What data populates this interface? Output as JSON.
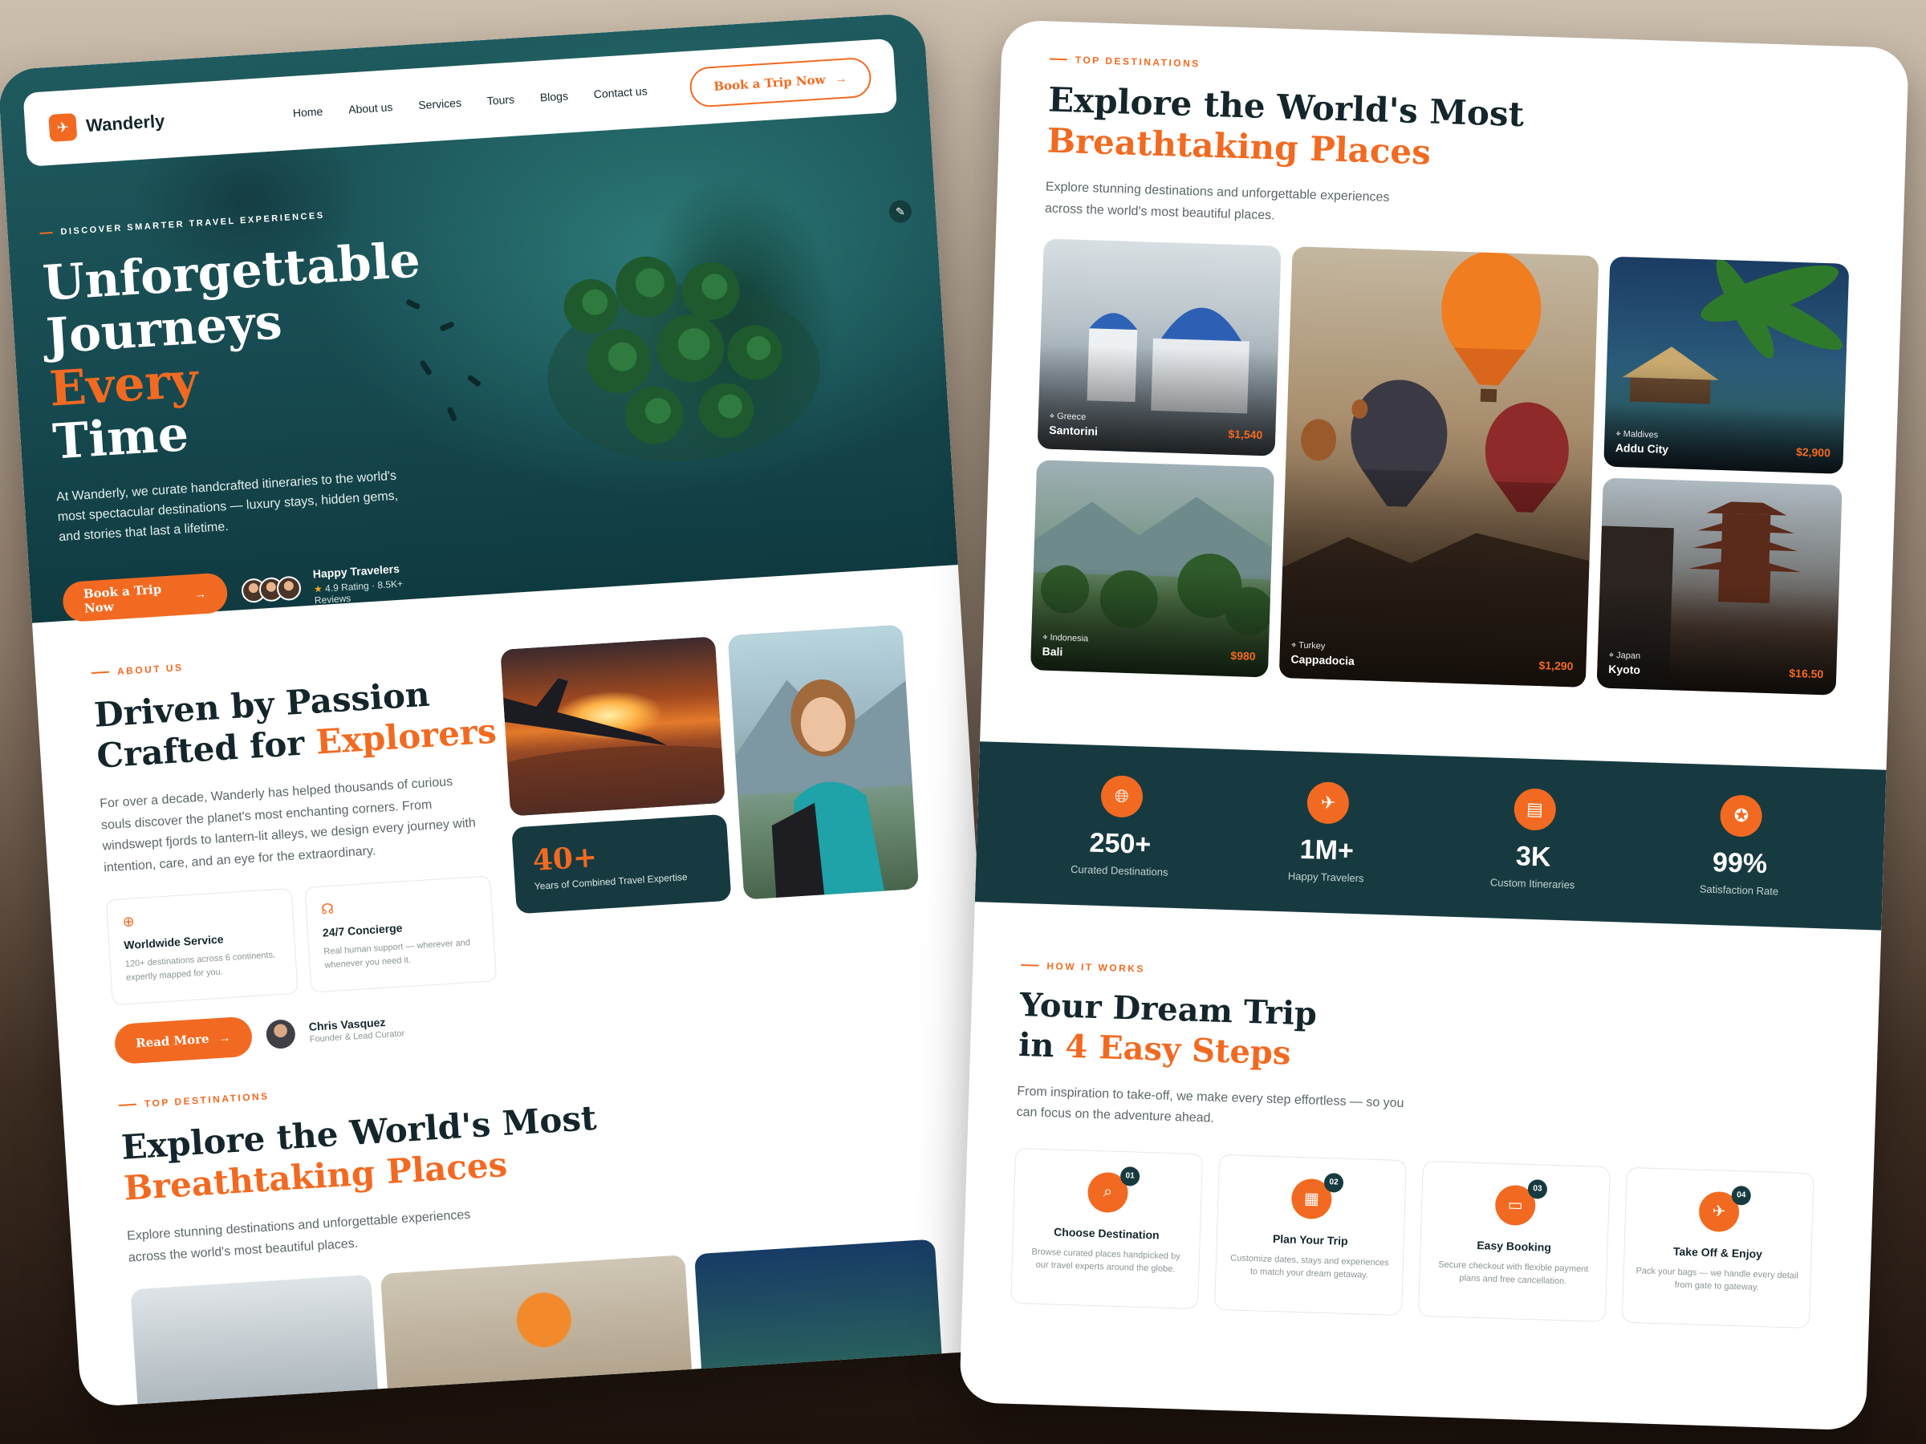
{
  "nav": {
    "brand": "Wanderly",
    "links": [
      "Home",
      "About us",
      "Services",
      "Tours",
      "Blogs",
      "Contact us"
    ],
    "cta": "Book a Trip Now"
  },
  "hero": {
    "kicker": "DISCOVER SMARTER TRAVEL EXPERIENCES",
    "title_line1": "Unforgettable",
    "title_line2a": "Journeys",
    "title_line2b": "Every",
    "title_line3": "Time",
    "description": "At Wanderly, we curate handcrafted itineraries to the world's most spectacular destinations — luxury stays, hidden gems, and stories that last a lifetime.",
    "cta": "Book a Trip Now",
    "social_title": "Happy Travelers",
    "social_sub": "4.9 Rating · 8.5K+ Reviews"
  },
  "about": {
    "kicker": "ABOUT US",
    "title_a": "Driven by Passion",
    "title_b": "Crafted for",
    "title_c": "Explorers",
    "description": "For over a decade, Wanderly has helped thousands of curious souls discover the planet's most enchanting corners. From windswept fjords to lantern-lit alleys, we design every journey with intention, care, and an eye for the extraordinary.",
    "features": [
      {
        "icon": "globe-icon",
        "title": "Worldwide Service",
        "text": "120+ destinations across 6 continents, expertly mapped for you."
      },
      {
        "icon": "headset-icon",
        "title": "24/7 Concierge",
        "text": "Real human support — wherever and whenever you need it."
      }
    ],
    "expertise_value": "40+",
    "expertise_label": "Years of Combined Travel Expertise",
    "cta": "Read More",
    "founder_name": "Chris Vasquez",
    "founder_role": "Founder & Lead Curator"
  },
  "destinations": {
    "kicker": "TOP DESTINATIONS",
    "title_a": "Explore the World's Most",
    "title_b": "Breathtaking Places",
    "description": "Explore stunning destinations and unforgettable experiences across the world's most beautiful places.",
    "cards": [
      {
        "country": "Greece",
        "city": "Santorini",
        "price": "$1,540"
      },
      {
        "country": "Indonesia",
        "city": "Bali",
        "price": "$980"
      },
      {
        "country": "Turkey",
        "city": "Cappadocia",
        "price": "$1,290"
      },
      {
        "country": "Maldives",
        "city": "Addu City",
        "price": "$2,900"
      },
      {
        "country": "Japan",
        "city": "Kyoto",
        "price": "$16.50"
      }
    ]
  },
  "stats": [
    {
      "icon": "globe-icon",
      "value": "250+",
      "label": "Curated Destinations"
    },
    {
      "icon": "plane-icon",
      "value": "1M+",
      "label": "Happy Travelers"
    },
    {
      "icon": "clipboard-icon",
      "value": "3K",
      "label": "Custom Itineraries"
    },
    {
      "icon": "award-icon",
      "value": "99%",
      "label": "Satisfaction Rate"
    }
  ],
  "how": {
    "kicker": "HOW IT WORKS",
    "title_a": "Your Dream Trip",
    "title_b": "in",
    "title_c": "4 Easy Steps",
    "description": "From inspiration to take-off, we make every step effortless — so you can focus on the adventure ahead.",
    "steps": [
      {
        "num": "01",
        "icon": "search-icon",
        "title": "Choose Destination",
        "text": "Browse curated places handpicked by our travel experts around the globe."
      },
      {
        "num": "02",
        "icon": "calendar-icon",
        "title": "Plan Your Trip",
        "text": "Customize dates, stays and experiences to match your dream getaway."
      },
      {
        "num": "03",
        "icon": "card-icon",
        "title": "Easy Booking",
        "text": "Secure checkout with flexible payment plans and free cancellation."
      },
      {
        "num": "04",
        "icon": "plane-icon",
        "title": "Take Off & Enjoy",
        "text": "Pack your bags — we handle every detail from gate to gateway."
      }
    ]
  },
  "colors": {
    "accent": "#f26a21",
    "dark_teal": "#173a40",
    "text_dark": "#14262b"
  }
}
